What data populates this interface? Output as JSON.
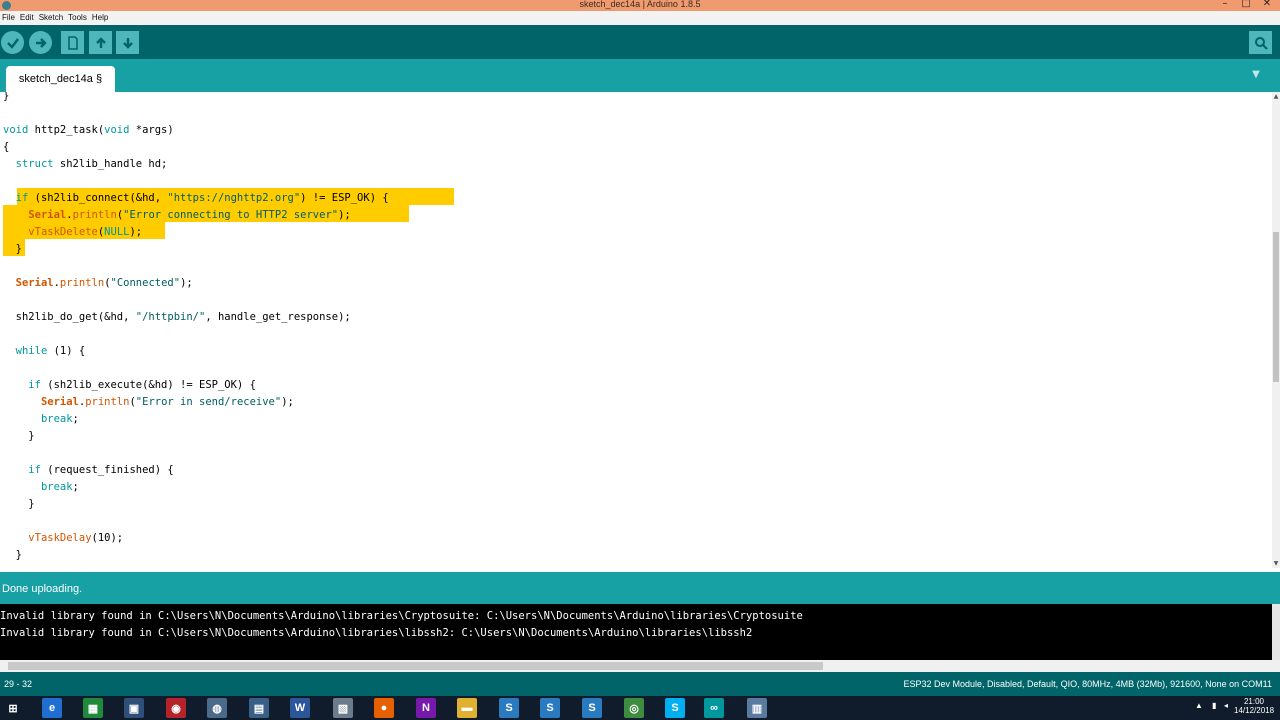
{
  "window": {
    "title": "sketch_dec14a | Arduino 1.8.5",
    "minimize": "–",
    "maximize": "□",
    "close": "✕"
  },
  "menu": [
    "File",
    "Edit",
    "Sketch",
    "Tools",
    "Help"
  ],
  "toolbar": {
    "verify_icon": "check-icon",
    "upload_icon": "arrow-right-icon",
    "new_icon": "document-icon",
    "open_icon": "arrow-up-icon",
    "save_icon": "arrow-down-icon",
    "serial_icon": "magnifier-icon"
  },
  "tab": {
    "label": "sketch_dec14a §",
    "menu_icon": "▼"
  },
  "editor": {
    "lines": [
      "}",
      "",
      "void http2_task(void *args)",
      "{",
      "  struct sh2lib_handle hd;",
      "",
      "  if (sh2lib_connect(&hd, \"https://nghttp2.org\") != ESP_OK) {",
      "    Serial.println(\"Error connecting to HTTP2 server\");",
      "    vTaskDelete(NULL);",
      "  }",
      "",
      "  Serial.println(\"Connected\");",
      "",
      "  sh2lib_do_get(&hd, \"/httpbin/\", handle_get_response);",
      "",
      "  while (1) {",
      "",
      "    if (sh2lib_execute(&hd) != ESP_OK) {",
      "      Serial.println(\"Error in send/receive\");",
      "      break;",
      "    }",
      "",
      "    if (request_finished) {",
      "      break;",
      "    }",
      "",
      "    vTaskDelay(10);",
      "  }"
    ]
  },
  "status": {
    "message": "Done uploading."
  },
  "console": {
    "lines": [
      "Invalid library found in C:\\Users\\N\\Documents\\Arduino\\libraries\\Cryptosuite: C:\\Users\\N\\Documents\\Arduino\\libraries\\Cryptosuite",
      "Invalid library found in C:\\Users\\N\\Documents\\Arduino\\libraries\\libssh2: C:\\Users\\N\\Documents\\Arduino\\libraries\\libssh2"
    ]
  },
  "footer": {
    "line_range": "29 - 32",
    "board": "ESP32 Dev Module, Disabled, Default, QIO, 80MHz, 4MB (32Mb), 921600, None on COM11"
  },
  "taskbar": {
    "clock_time": "21:00",
    "clock_date": "14/12/2018",
    "apps": [
      {
        "name": "windows-start-icon",
        "glyph": "⊞",
        "color": "#101c2c"
      },
      {
        "name": "ie-icon",
        "glyph": "e",
        "color": "#1e6fd0"
      },
      {
        "name": "spreadsheet-icon",
        "glyph": "▦",
        "color": "#1f8a3c"
      },
      {
        "name": "app-icon-1",
        "glyph": "▣",
        "color": "#2d4f7a"
      },
      {
        "name": "app-icon-2",
        "glyph": "◉",
        "color": "#b5222a"
      },
      {
        "name": "app-icon-3",
        "glyph": "◍",
        "color": "#4a6a8a"
      },
      {
        "name": "app-icon-4",
        "glyph": "▤",
        "color": "#3a5f86"
      },
      {
        "name": "word-icon",
        "glyph": "W",
        "color": "#2b579a"
      },
      {
        "name": "pdf-icon",
        "glyph": "▧",
        "color": "#6a7b8c"
      },
      {
        "name": "firefox-icon",
        "glyph": "●",
        "color": "#e66000"
      },
      {
        "name": "onenote-icon",
        "glyph": "N",
        "color": "#7719aa"
      },
      {
        "name": "folder-icon",
        "glyph": "▬",
        "color": "#e0b030"
      },
      {
        "name": "tool-icon-1",
        "glyph": "S",
        "color": "#2a7ac0"
      },
      {
        "name": "tool-icon-2",
        "glyph": "S",
        "color": "#2a7ac0"
      },
      {
        "name": "tool-icon-3",
        "glyph": "S",
        "color": "#2a7ac0"
      },
      {
        "name": "chrome-icon",
        "glyph": "◎",
        "color": "#3d8c40"
      },
      {
        "name": "skype-icon",
        "glyph": "S",
        "color": "#00aff0"
      },
      {
        "name": "arduino-icon",
        "glyph": "∞",
        "color": "#00979d"
      },
      {
        "name": "app-icon-5",
        "glyph": "▥",
        "color": "#5a7aa0"
      }
    ]
  }
}
